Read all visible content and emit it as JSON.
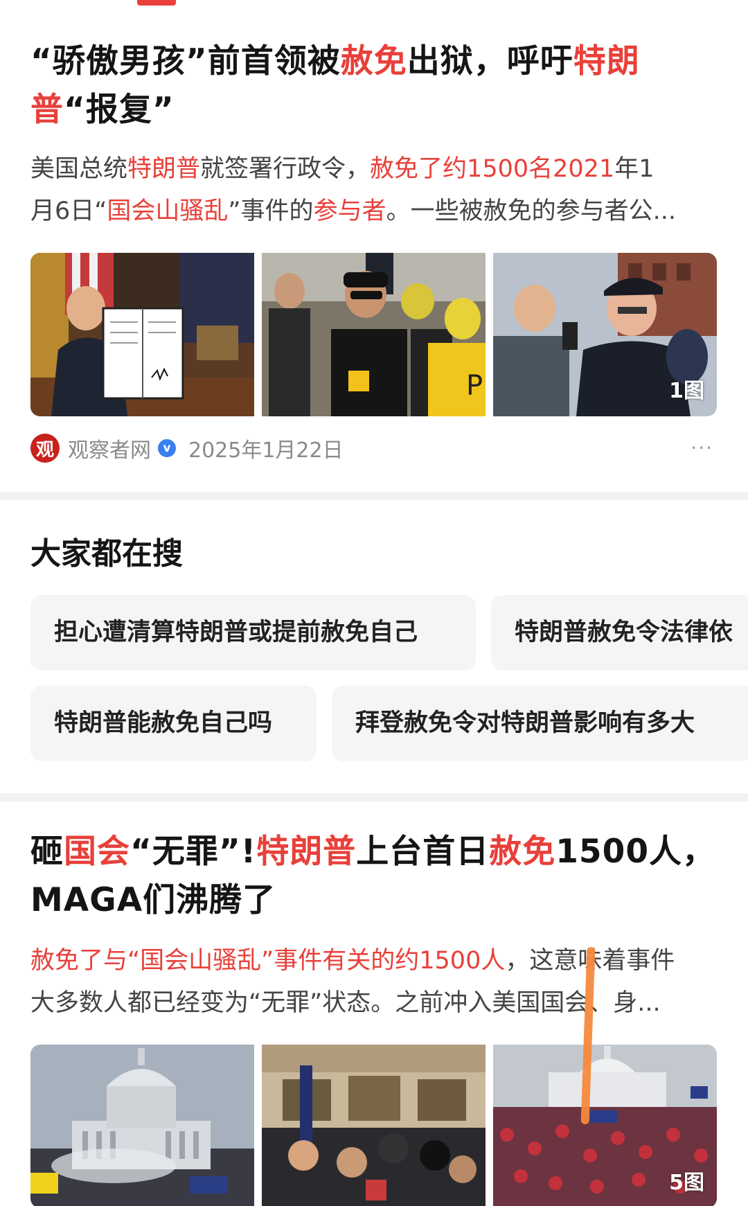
{
  "tab_indicator_color": "#e8403a",
  "highlight_color": "#e8403a",
  "articles": [
    {
      "headline": [
        {
          "text": "“骄傲男孩”前首领被",
          "hl": false
        },
        {
          "text": "赦免",
          "hl": true
        },
        {
          "text": "出狱，呼吁",
          "hl": false
        },
        {
          "text": "特朗普",
          "hl": true
        },
        {
          "text": "“报复”",
          "hl": false
        }
      ],
      "snippet_line1": [
        {
          "text": "美国总统",
          "hl": false
        },
        {
          "text": "特朗普",
          "hl": true
        },
        {
          "text": "就签署行政令，",
          "hl": false
        },
        {
          "text": "赦免了约1500名2021",
          "hl": true
        },
        {
          "text": "年1",
          "hl": false
        }
      ],
      "snippet_line2": [
        {
          "text": "月6日“",
          "hl": false
        },
        {
          "text": "国会山骚乱",
          "hl": true
        },
        {
          "text": "”事件的",
          "hl": false
        },
        {
          "text": "参与者",
          "hl": true
        },
        {
          "text": "。一些被赦免的参与者公...",
          "hl": false
        }
      ],
      "image_count": "1图",
      "source": {
        "name": "观察者网",
        "logo_char": "观",
        "verified_icon": "verified-badge-icon",
        "date": "2025年1月22日"
      },
      "more_label": "···"
    },
    {
      "headline": [
        {
          "text": "砸",
          "hl": false
        },
        {
          "text": "国会",
          "hl": true
        },
        {
          "text": "“无罪”!",
          "hl": false
        },
        {
          "text": "特朗普",
          "hl": true
        },
        {
          "text": "上台首日",
          "hl": false
        },
        {
          "text": "赦免",
          "hl": true
        },
        {
          "text": "1500人，MAGA们沸腾了",
          "hl": false
        }
      ],
      "snippet_line1": [
        {
          "text": "赦免了与“国会山骚乱”事件有关的约1500人",
          "hl": true
        },
        {
          "text": "，这意味着事件",
          "hl": false
        }
      ],
      "snippet_line2": [
        {
          "text": "大多数人都已经变为“无罪”状态。之前冲入美国国会、身...",
          "hl": false
        }
      ],
      "image_count": "5图"
    }
  ],
  "search_section": {
    "title": "大家都在搜",
    "chips_row1": [
      "担心遭清算特朗普或提前赦免自己",
      "特朗普赦免令法律依"
    ],
    "chips_row2": [
      "特朗普能赦免自己吗",
      "拜登赦免令对特朗普影响有多大"
    ]
  }
}
